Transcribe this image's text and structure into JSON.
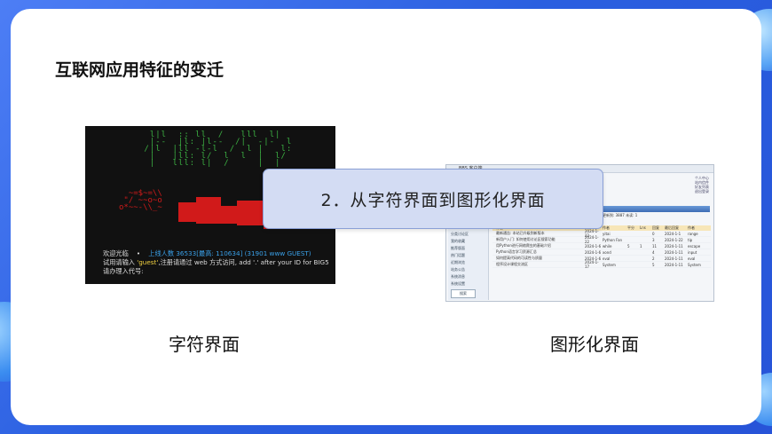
{
  "page_title": "互联网应用特征的变迁",
  "callout": "2．从字符界面到图形化界面",
  "captions": {
    "left": "字符界面",
    "right": "图形化界面"
  },
  "terminal": {
    "line1_a": "欢迎光临",
    "line1_b": "上线人数 36533[最高: 110634] (31901 www GUEST)",
    "line2_a": "试用请输入",
    "line2_q": "'guest'",
    "line2_b": ",注册请通过 web 方式访问, add '.' after your ID for BIG5",
    "line3": "请办理入代号:"
  },
  "gui": {
    "window_title": "BBS 客户端",
    "toolbar_text": "更新到: 3887 未读: 1",
    "right_links": [
      "个人中心",
      "站内信件",
      "好友列表",
      "退出登录"
    ],
    "sidebar": [
      "全部讨论区",
      "分类讨论区",
      "我的收藏",
      "推荐版面",
      "热门话题",
      "近期浏览",
      "站务公告",
      "系统消息",
      "系统设置"
    ],
    "sidebar_button": "搜索",
    "headers": [
      "标题",
      "",
      "作者",
      "平分",
      "Lns",
      "回复",
      "最后回复",
      "作者"
    ],
    "rows": [
      [
        "最新通告: 本站已升级到新版本",
        "2024-1-22",
        "yitai",
        "",
        "",
        "0",
        "2024-1-1",
        "range"
      ],
      [
        "新用户入门: 如何使用讨论区搜索功能",
        "2024-1-22",
        "Python Fan",
        "",
        "",
        "3",
        "2024-1-22",
        "tip"
      ],
      [
        "用Python进行网络爬虫的基础介绍",
        "2024-1-6",
        "while",
        "5",
        "1",
        "11",
        "2024-1-11",
        "escape"
      ],
      [
        "Python语言学习资源汇总",
        "2024-1-6",
        "xond",
        "",
        "",
        "4",
        "2024-1-11",
        "input"
      ],
      [
        "如何提高代码的可读性与质量",
        "2024-1-6",
        "eval",
        "",
        "",
        "2",
        "2024-1-11",
        "eval"
      ],
      [
        "程序设计课程交流区",
        "2024-1-17",
        "System",
        "",
        "",
        "5",
        "2024-1-11",
        "System"
      ]
    ]
  }
}
